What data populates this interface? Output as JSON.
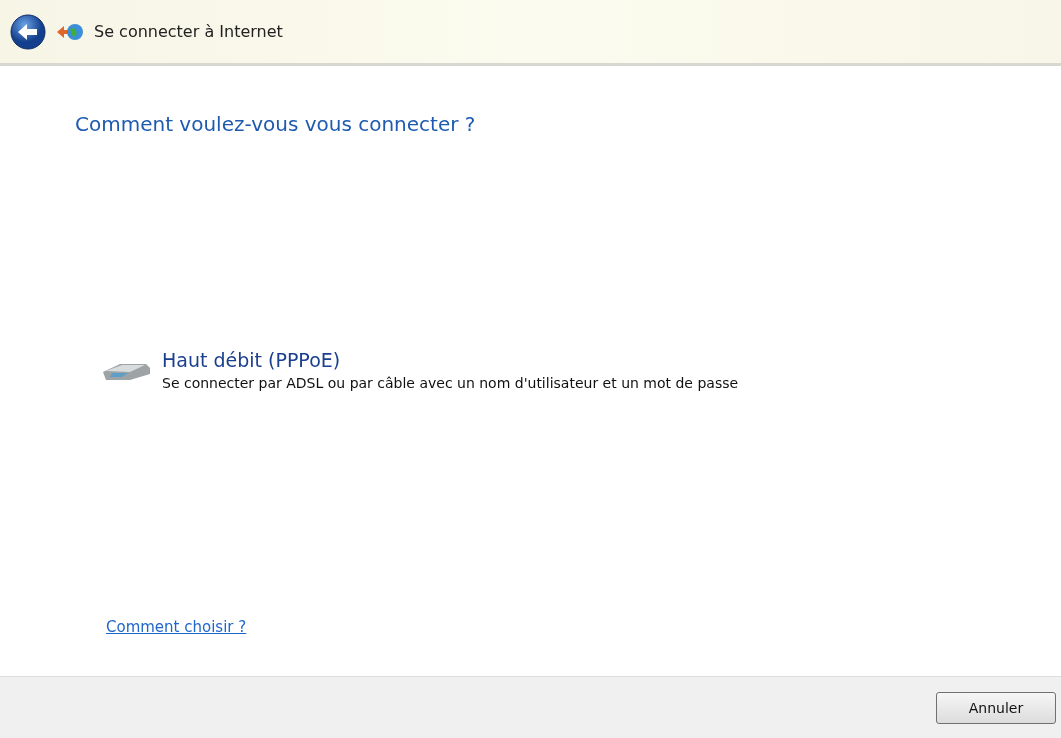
{
  "window": {
    "title": "Se connecter à Internet"
  },
  "heading": "Comment voulez-vous vous connecter ?",
  "options": [
    {
      "title": "Haut débit (PPPoE)",
      "description": "Se connecter par ADSL ou par câble avec un nom d'utilisateur et un mot de passe"
    }
  ],
  "help_link": "Comment choisir ?",
  "buttons": [
    "Annuler"
  ]
}
